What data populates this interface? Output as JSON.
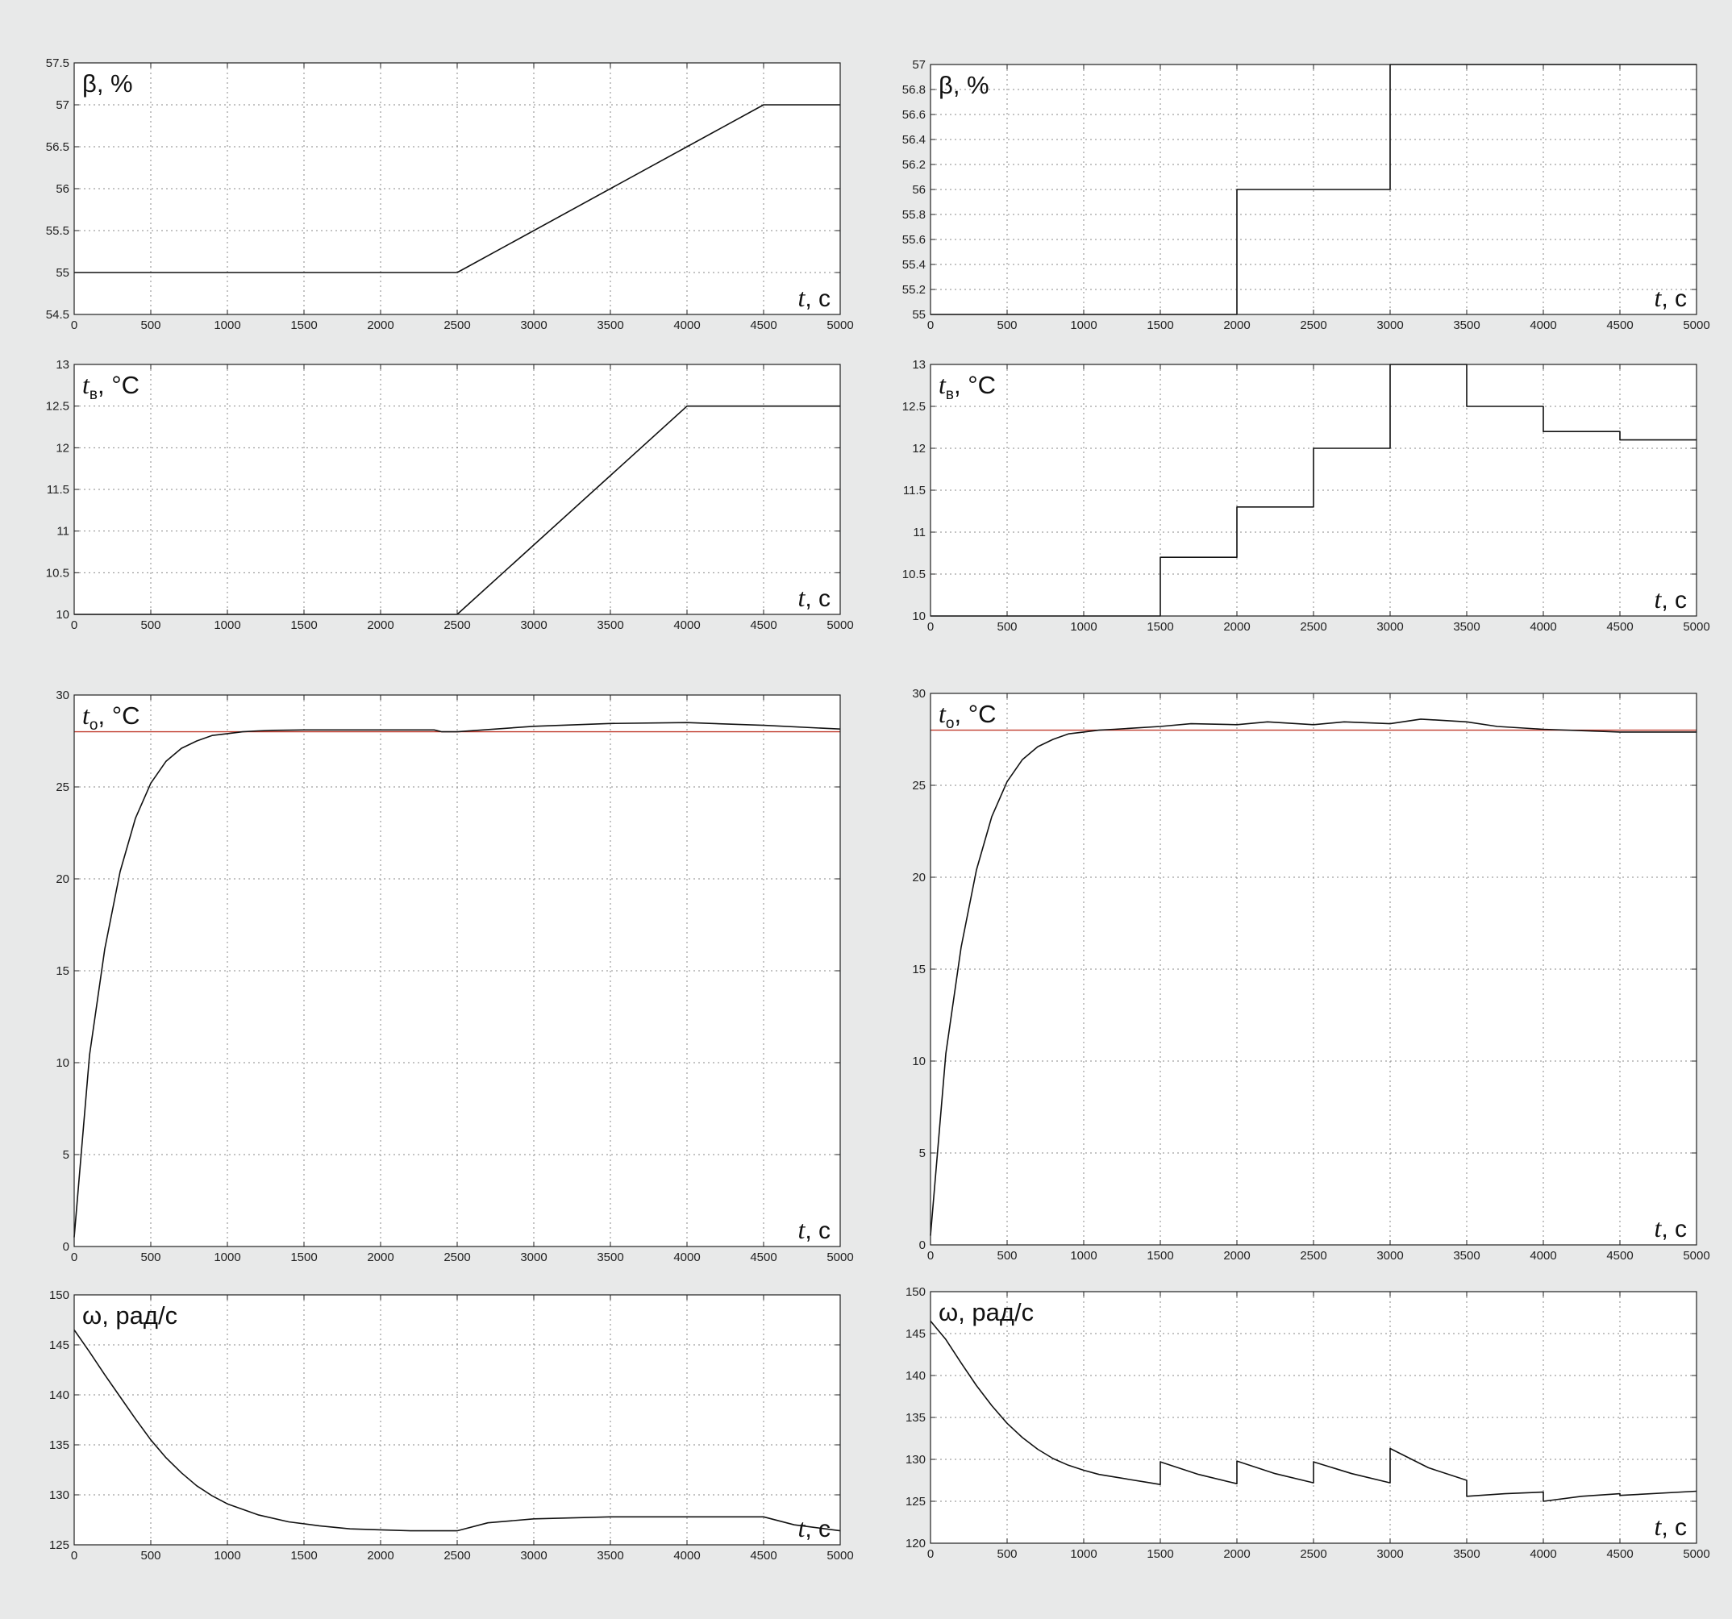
{
  "chart_data": [
    {
      "type": "line",
      "ylabel": {
        "main": "β, %",
        "sub": ""
      },
      "xlabel": {
        "var": "t",
        "unit": ", с"
      },
      "xlim": [
        0,
        5000
      ],
      "ylim": [
        54.5,
        57.5
      ],
      "xticks": [
        0,
        500,
        1000,
        1500,
        2000,
        2500,
        3000,
        3500,
        4000,
        4500,
        5000
      ],
      "yticks": [
        "54.5",
        "55",
        "55.5",
        "56",
        "56.5",
        "57",
        "57.5"
      ],
      "grid": true,
      "series": [
        {
          "color": "#111111",
          "x": [
            0,
            2500,
            4500,
            5000
          ],
          "y": [
            55,
            55,
            57,
            57
          ]
        }
      ]
    },
    {
      "type": "line",
      "ylabel": {
        "main": "β, %",
        "sub": ""
      },
      "xlabel": {
        "var": "t",
        "unit": ", с"
      },
      "xlim": [
        0,
        5000
      ],
      "ylim": [
        55,
        57
      ],
      "xticks": [
        0,
        500,
        1000,
        1500,
        2000,
        2500,
        3000,
        3500,
        4000,
        4500,
        5000
      ],
      "yticks": [
        "55",
        "55.2",
        "55.4",
        "55.6",
        "55.8",
        "56",
        "56.2",
        "56.4",
        "56.6",
        "56.8",
        "57"
      ],
      "grid": true,
      "series": [
        {
          "color": "#111111",
          "x": [
            0,
            2000,
            2000,
            3000,
            3000,
            5000
          ],
          "y": [
            55,
            55,
            56,
            56,
            57,
            57
          ]
        }
      ]
    },
    {
      "type": "line",
      "ylabel": {
        "main": "t",
        "sub": "в",
        "unit": ", °C"
      },
      "xlabel": {
        "var": "t",
        "unit": ", с"
      },
      "xlim": [
        0,
        5000
      ],
      "ylim": [
        10,
        13
      ],
      "xticks": [
        0,
        500,
        1000,
        1500,
        2000,
        2500,
        3000,
        3500,
        4000,
        4500,
        5000
      ],
      "yticks": [
        "10",
        "10.5",
        "11",
        "11.5",
        "12",
        "12.5",
        "13"
      ],
      "grid": true,
      "series": [
        {
          "color": "#111111",
          "x": [
            0,
            2500,
            4000,
            5000
          ],
          "y": [
            10,
            10,
            12.5,
            12.5
          ]
        }
      ]
    },
    {
      "type": "line",
      "ylabel": {
        "main": "t",
        "sub": "в",
        "unit": ", °C"
      },
      "xlabel": {
        "var": "t",
        "unit": ", с"
      },
      "xlim": [
        0,
        5000
      ],
      "ylim": [
        10,
        13
      ],
      "xticks": [
        0,
        500,
        1000,
        1500,
        2000,
        2500,
        3000,
        3500,
        4000,
        4500,
        5000
      ],
      "yticks": [
        "10",
        "10.5",
        "11",
        "11.5",
        "12",
        "12.5",
        "13"
      ],
      "grid": true,
      "series": [
        {
          "color": "#111111",
          "x": [
            0,
            1500,
            1500,
            2000,
            2000,
            2500,
            2500,
            3000,
            3000,
            3500,
            3500,
            4000,
            4000,
            4500,
            4500,
            5000
          ],
          "y": [
            10,
            10,
            10.7,
            10.7,
            11.3,
            11.3,
            12,
            12,
            13,
            13,
            12.5,
            12.5,
            12.2,
            12.2,
            12.1,
            12.1
          ]
        }
      ]
    },
    {
      "type": "line",
      "ylabel": {
        "main": "t",
        "sub": "о",
        "unit": ", °C"
      },
      "xlabel": {
        "var": "t",
        "unit": ", с"
      },
      "xlim": [
        0,
        5000
      ],
      "ylim": [
        0,
        30
      ],
      "xticks": [
        0,
        500,
        1000,
        1500,
        2000,
        2500,
        3000,
        3500,
        4000,
        4500,
        5000
      ],
      "yticks": [
        "0",
        "5",
        "10",
        "15",
        "20",
        "25",
        "30"
      ],
      "grid": true,
      "series": [
        {
          "color": "#c0392b",
          "x": [
            0,
            5000
          ],
          "y": [
            28,
            28
          ]
        },
        {
          "color": "#111111",
          "x": [
            0,
            100,
            200,
            300,
            400,
            500,
            600,
            700,
            800,
            900,
            1000,
            1100,
            1200,
            1300,
            1500,
            2000,
            2350,
            2400,
            2500,
            3000,
            3500,
            4000,
            4500,
            5000
          ],
          "y": [
            0.5,
            10.4,
            16.2,
            20.4,
            23.3,
            25.2,
            26.4,
            27.1,
            27.5,
            27.8,
            27.9,
            28.0,
            28.05,
            28.08,
            28.1,
            28.1,
            28.1,
            28.0,
            28.0,
            28.3,
            28.45,
            28.5,
            28.35,
            28.15
          ]
        }
      ]
    },
    {
      "type": "line",
      "ylabel": {
        "main": "t",
        "sub": "о",
        "unit": ", °C"
      },
      "xlabel": {
        "var": "t",
        "unit": ", с"
      },
      "xlim": [
        0,
        5000
      ],
      "ylim": [
        0,
        30
      ],
      "xticks": [
        0,
        500,
        1000,
        1500,
        2000,
        2500,
        3000,
        3500,
        4000,
        4500,
        5000
      ],
      "yticks": [
        "0",
        "5",
        "10",
        "15",
        "20",
        "25",
        "30"
      ],
      "grid": true,
      "series": [
        {
          "color": "#c0392b",
          "x": [
            0,
            5000
          ],
          "y": [
            28,
            28
          ]
        },
        {
          "color": "#111111",
          "x": [
            0,
            100,
            200,
            300,
            400,
            500,
            600,
            700,
            800,
            900,
            1000,
            1100,
            1200,
            1300,
            1500,
            1700,
            2000,
            2200,
            2500,
            2700,
            3000,
            3200,
            3500,
            3700,
            4000,
            4500,
            5000
          ],
          "y": [
            0.5,
            10.4,
            16.2,
            20.4,
            23.3,
            25.2,
            26.4,
            27.1,
            27.5,
            27.8,
            27.9,
            28.0,
            28.05,
            28.1,
            28.2,
            28.35,
            28.3,
            28.45,
            28.3,
            28.45,
            28.35,
            28.6,
            28.45,
            28.2,
            28.05,
            27.9,
            27.9
          ]
        }
      ]
    },
    {
      "type": "line",
      "ylabel": {
        "main": "ω, рад/с",
        "sub": ""
      },
      "xlabel": {
        "var": "t",
        "unit": ", с"
      },
      "xlim": [
        0,
        5000
      ],
      "ylim": [
        125,
        150
      ],
      "xticks": [
        0,
        500,
        1000,
        1500,
        2000,
        2500,
        3000,
        3500,
        4000,
        4500,
        5000
      ],
      "yticks": [
        "125",
        "130",
        "135",
        "140",
        "145",
        "150"
      ],
      "grid": true,
      "series": [
        {
          "color": "#111111",
          "x": [
            0,
            100,
            200,
            300,
            400,
            500,
            600,
            700,
            800,
            900,
            1000,
            1200,
            1400,
            1600,
            1800,
            2000,
            2200,
            2500,
            2700,
            3000,
            3500,
            4000,
            4500,
            4700,
            5000
          ],
          "y": [
            146.5,
            144.3,
            142.0,
            139.8,
            137.6,
            135.5,
            133.7,
            132.2,
            130.9,
            129.9,
            129.1,
            128.0,
            127.3,
            126.9,
            126.6,
            126.5,
            126.4,
            126.4,
            127.2,
            127.6,
            127.8,
            127.8,
            127.8,
            127.0,
            126.4
          ]
        }
      ]
    },
    {
      "type": "line",
      "ylabel": {
        "main": "ω, рад/с",
        "sub": ""
      },
      "xlabel": {
        "var": "t",
        "unit": ", с"
      },
      "xlim": [
        0,
        5000
      ],
      "ylim": [
        120,
        150
      ],
      "xticks": [
        0,
        500,
        1000,
        1500,
        2000,
        2500,
        3000,
        3500,
        4000,
        4500,
        5000
      ],
      "yticks": [
        "120",
        "125",
        "130",
        "135",
        "140",
        "145",
        "150"
      ],
      "grid": true,
      "series": [
        {
          "color": "#111111",
          "x": [
            0,
            100,
            200,
            300,
            400,
            500,
            600,
            700,
            800,
            900,
            1000,
            1100,
            1200,
            1300,
            1400,
            1500,
            1500,
            1750,
            2000,
            2000,
            2250,
            2500,
            2500,
            2750,
            3000,
            3000,
            3250,
            3500,
            3500,
            3750,
            4000,
            4000,
            4250,
            4500,
            4500,
            5000
          ],
          "y": [
            146.5,
            144.3,
            141.5,
            138.8,
            136.4,
            134.3,
            132.6,
            131.2,
            130.1,
            129.3,
            128.7,
            128.2,
            127.9,
            127.6,
            127.3,
            127.0,
            129.7,
            128.2,
            127.1,
            129.8,
            128.3,
            127.2,
            129.7,
            128.3,
            127.2,
            131.3,
            129.0,
            127.5,
            125.6,
            125.9,
            126.1,
            125.0,
            125.6,
            125.9,
            125.7,
            126.2
          ]
        }
      ]
    }
  ]
}
